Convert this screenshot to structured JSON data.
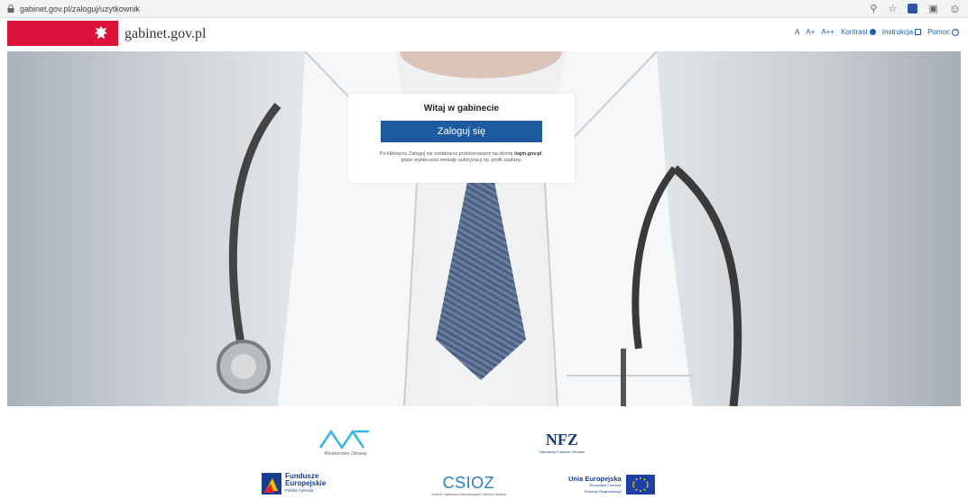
{
  "browser": {
    "url": "gabinet.gov.pl/zaloguj/uzytkownik",
    "icons": [
      "zoom-icon",
      "star-icon",
      "extension-icon",
      "camera-icon",
      "profile-icon"
    ]
  },
  "header": {
    "brand": "gabinet.gov.pl",
    "font_sizes": [
      "A",
      "A+",
      "A++"
    ],
    "contrast_label": "Kontrast",
    "instruction_label": "Instrukcja",
    "help_label": "Pomoc",
    "accent_color": "#dc143c",
    "link_color": "#1f5ea8"
  },
  "login": {
    "title": "Witaj w gabinecie",
    "button_label": "Zaloguj się",
    "note_pre": "Po kliknięciu Zaloguj się zostaniesz przekierowany na stronę",
    "note_bold": "login.gov.pl",
    "note_post": ", gdzie wybierzesz metodę autoryzacji np. profil zaufany.",
    "button_color": "#1d5b9e"
  },
  "footer_logos": {
    "mz": "Ministerstwo Zdrowia",
    "nfz": "NFZ",
    "nfz_sub": "Narodowy Fundusz Zdrowia",
    "fe_line1": "Fundusze",
    "fe_line2": "Europejskie",
    "fe_line3": "Polska Cyfrowa",
    "csioz": "CSIOZ",
    "csioz_sub": "Centrum Systemów Informacyjnych Ochrony Zdrowia",
    "ue_title": "Unia Europejska",
    "ue_sub1": "Europejski Fundusz",
    "ue_sub2": "Rozwoju Regionalnego"
  }
}
